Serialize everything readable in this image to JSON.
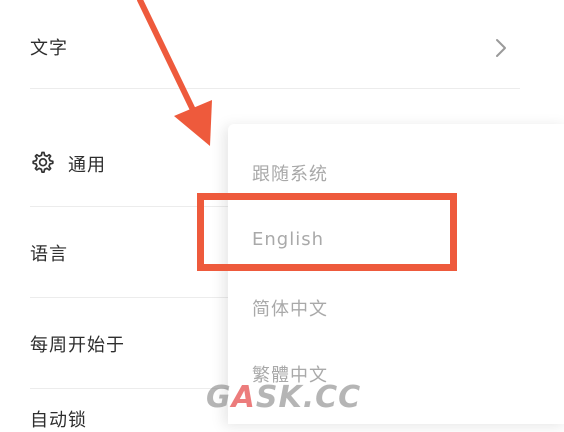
{
  "settings": {
    "text_label": "文字",
    "general_label": "通用",
    "language_label": "语言",
    "week_start_label": "每周开始于",
    "partial_next_label": "自动锁"
  },
  "language_menu": {
    "options": [
      "跟随系统",
      "English",
      "简体中文",
      "繁體中文"
    ]
  },
  "watermark": {
    "prefix": "G",
    "accent": "A",
    "suffix": "SK.CC"
  },
  "colors": {
    "highlight": "#ee5a3c",
    "option_text": "#a9a9a9",
    "row_text": "#2e2e2e"
  },
  "icons": {
    "general": "gear-icon",
    "text_row": "chevron-right-icon"
  }
}
